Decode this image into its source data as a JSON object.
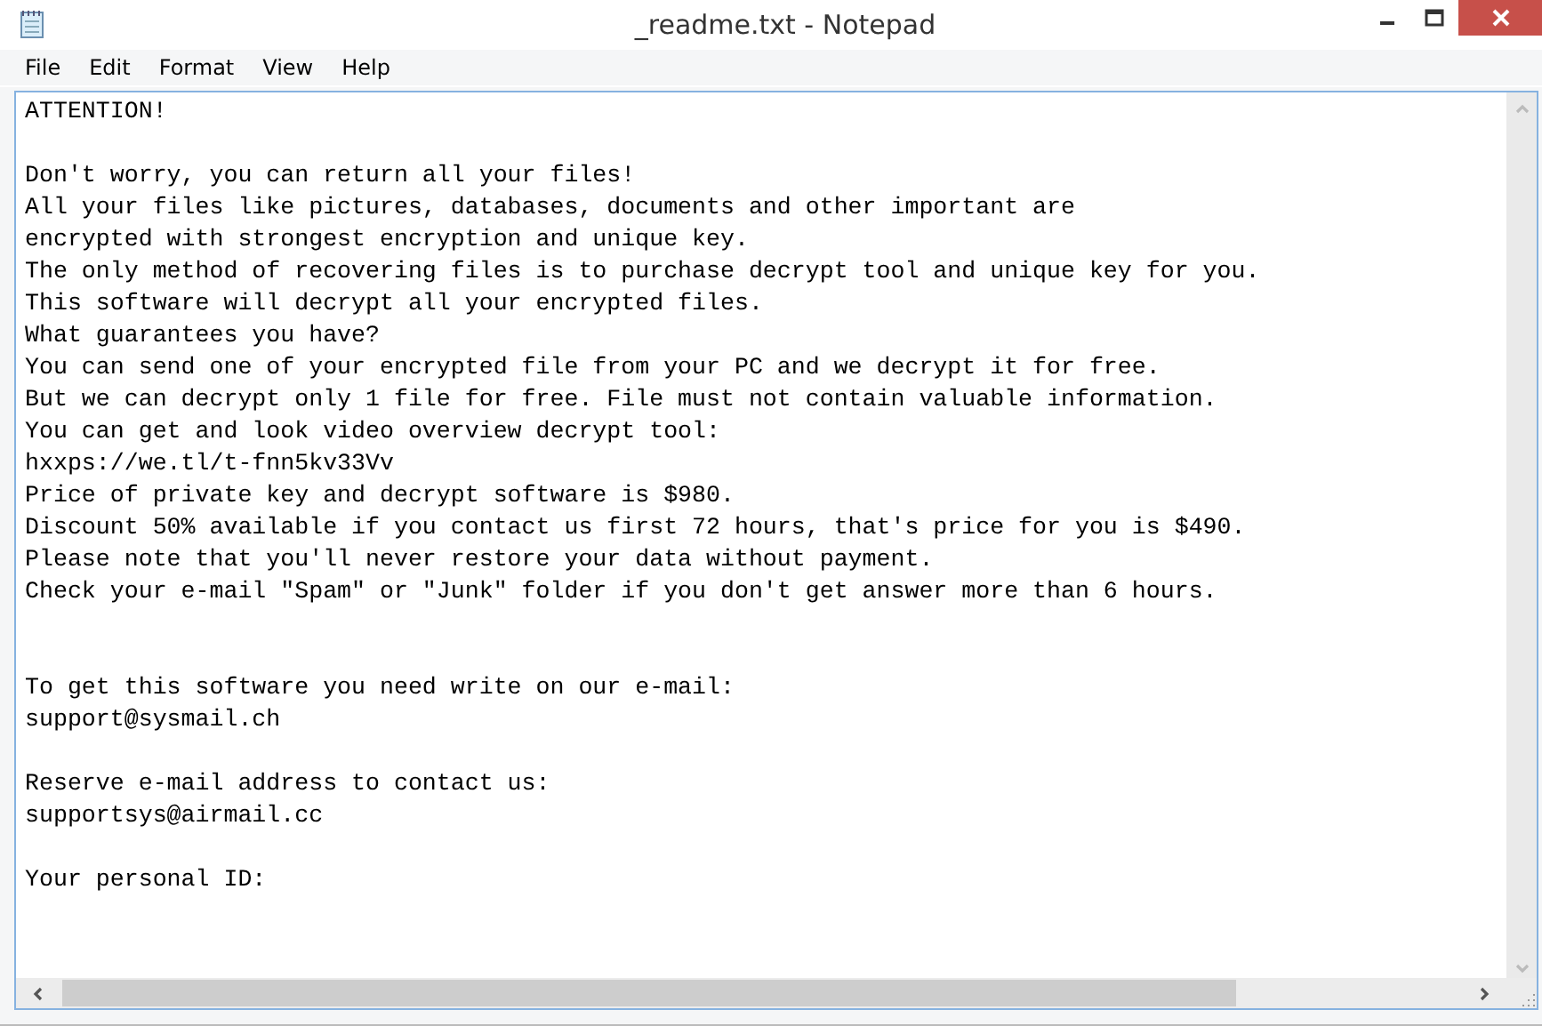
{
  "window": {
    "title": "_readme.txt - Notepad"
  },
  "menu": [
    "File",
    "Edit",
    "Format",
    "View",
    "Help"
  ],
  "document": {
    "text": "ATTENTION!\n\nDon't worry, you can return all your files!\nAll your files like pictures, databases, documents and other important are\nencrypted with strongest encryption and unique key.\nThe only method of recovering files is to purchase decrypt tool and unique key for you.\nThis software will decrypt all your encrypted files.\nWhat guarantees you have?\nYou can send one of your encrypted file from your PC and we decrypt it for free.\nBut we can decrypt only 1 file for free. File must not contain valuable information.\nYou can get and look video overview decrypt tool:\nhxxps://we.tl/t-fnn5kv33Vv\nPrice of private key and decrypt software is $980.\nDiscount 50% available if you contact us first 72 hours, that's price for you is $490.\nPlease note that you'll never restore your data without payment.\nCheck your e-mail \"Spam\" or \"Junk\" folder if you don't get answer more than 6 hours.\n\n\nTo get this software you need write on our e-mail:\nsupport@sysmail.ch\n\nReserve e-mail address to contact us:\nsupportsys@airmail.cc\n\nYour personal ID:"
  }
}
